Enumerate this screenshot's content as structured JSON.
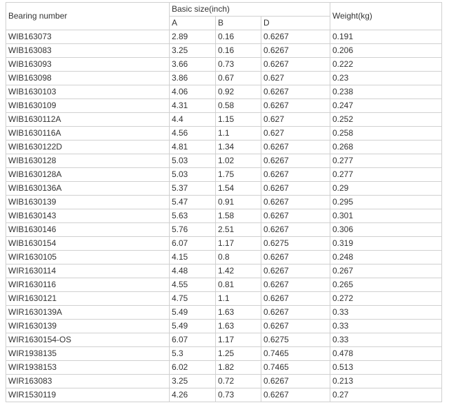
{
  "headers": {
    "bearing_number": "Bearing number",
    "basic_size": "Basic size(inch)",
    "col_a": "A",
    "col_b": "B",
    "col_d": "D",
    "weight": "Weight(kg)"
  },
  "rows": [
    [
      "WIB163073",
      "2.89",
      "0.16",
      "0.6267",
      "0.191"
    ],
    [
      "WIB163083",
      "3.25",
      "0.16",
      "0.6267",
      "0.206"
    ],
    [
      "WIB163093",
      "3.66",
      "0.73",
      "0.6267",
      "0.222"
    ],
    [
      "WIB163098",
      "3.86",
      "0.67",
      "0.627",
      "0.23"
    ],
    [
      "WIB1630103",
      "4.06",
      "0.92",
      "0.6267",
      "0.238"
    ],
    [
      "WIB1630109",
      "4.31",
      "0.58",
      "0.6267",
      "0.247"
    ],
    [
      "WIB1630112A",
      "4.4",
      "1.15",
      "0.627",
      "0.252"
    ],
    [
      "WIB1630116A",
      "4.56",
      "1.1",
      "0.627",
      "0.258"
    ],
    [
      "WIB1630122D",
      "4.81",
      "1.34",
      "0.6267",
      "0.268"
    ],
    [
      "WIB1630128",
      "5.03",
      "1.02",
      "0.6267",
      "0.277"
    ],
    [
      "WIB1630128A",
      "5.03",
      "1.75",
      "0.6267",
      "0.277"
    ],
    [
      "WIB1630136A",
      "5.37",
      "1.54",
      "0.6267",
      "0.29"
    ],
    [
      "WIB1630139",
      "5.47",
      "0.91",
      "0.6267",
      "0.295"
    ],
    [
      "WIB1630143",
      "5.63",
      "1.58",
      "0.6267",
      "0.301"
    ],
    [
      "WIB1630146",
      "5.76",
      "2.51",
      "0.6267",
      "0.306"
    ],
    [
      "WIB1630154",
      "6.07",
      "1.17",
      "0.6275",
      "0.319"
    ],
    [
      "WIR1630105",
      "4.15",
      "0.8",
      "0.6267",
      "0.248"
    ],
    [
      "WIR1630114",
      "4.48",
      "1.42",
      "0.6267",
      "0.267"
    ],
    [
      "WIR1630116",
      "4.55",
      "0.81",
      "0.6267",
      "0.265"
    ],
    [
      "WIR1630121",
      "4.75",
      "1.1",
      "0.6267",
      "0.272"
    ],
    [
      "WIR1630139A",
      "5.49",
      "1.63",
      "0.6267",
      "0.33"
    ],
    [
      "WIR1630139",
      "5.49",
      "1.63",
      "0.6267",
      "0.33"
    ],
    [
      "WIR1630154-OS",
      "6.07",
      "1.17",
      "0.6275",
      "0.33"
    ],
    [
      "WIR1938135",
      "5.3",
      "1.25",
      "0.7465",
      "0.478"
    ],
    [
      "WIR1938153",
      "6.02",
      "1.82",
      "0.7465",
      "0.513"
    ],
    [
      "WIR163083",
      "3.25",
      "0.72",
      "0.6267",
      "0.213"
    ],
    [
      "WIR1530119",
      "4.26",
      "0.73",
      "0.6267",
      "0.27"
    ]
  ]
}
